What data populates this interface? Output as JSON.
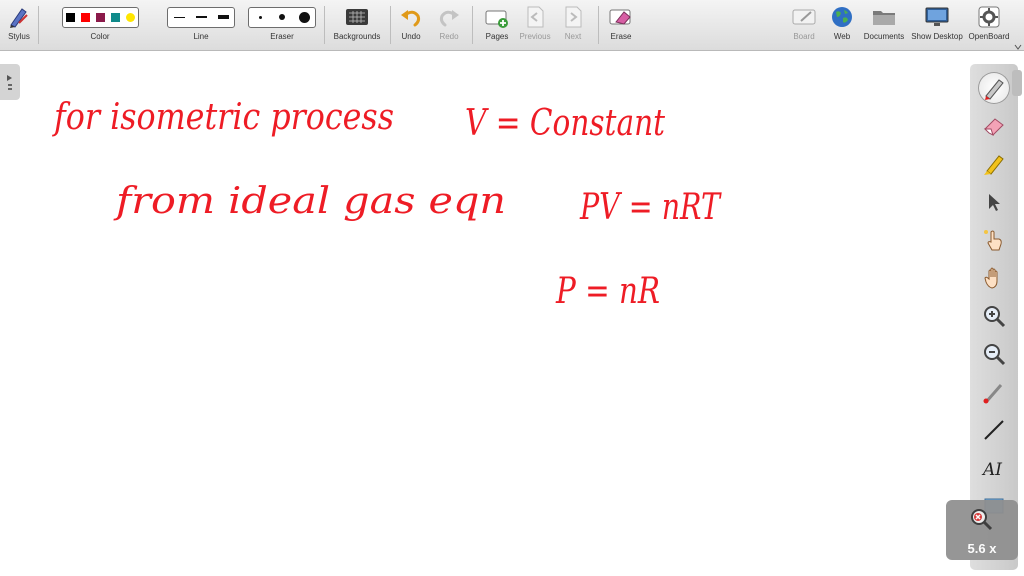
{
  "toolbar": {
    "stylus": "Stylus",
    "color": "Color",
    "line": "Line",
    "eraser": "Eraser",
    "backgrounds": "Backgrounds",
    "undo": "Undo",
    "redo": "Redo",
    "pages": "Pages",
    "previous": "Previous",
    "next": "Next",
    "erase": "Erase",
    "board": "Board",
    "web": "Web",
    "documents": "Documents",
    "show_desktop": "Show Desktop",
    "openboard": "OpenBoard",
    "colors": [
      "#000000",
      "#ff0000",
      "#8b1a4a",
      "#0f8a8a",
      "#ffe600"
    ]
  },
  "board": {
    "ink_color": "#ee1c25",
    "line1a": "for isometric process",
    "line1b": "V = Constant",
    "line2a": "from ideal gas eqn",
    "line2b": "PV = nRT",
    "line3": "P = nR"
  },
  "zoom": {
    "value": "5.6 x"
  },
  "right_tools": [
    "pen-icon",
    "eraser-icon",
    "highlighter-icon",
    "pointer-icon",
    "laser-pointer-icon",
    "hand-icon",
    "zoom-in-icon",
    "zoom-out-icon",
    "magnifier-icon",
    "line-icon",
    "text-icon"
  ]
}
